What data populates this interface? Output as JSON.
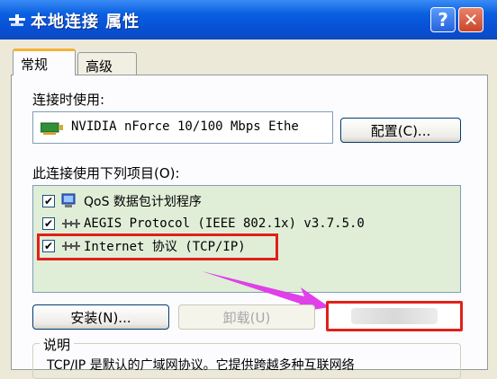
{
  "window": {
    "title": "本地连接 属性",
    "help_symbol": "?",
    "close_symbol": "✕"
  },
  "tabs": [
    {
      "label": "常规",
      "active": true
    },
    {
      "label": "高级",
      "active": false
    }
  ],
  "connect_using": {
    "label": "连接时使用:",
    "adapter": "NVIDIA nForce 10/100 Mbps Ethe",
    "configure_button": "配置(C)..."
  },
  "components": {
    "label": "此连接使用下列项目(O):",
    "items": [
      {
        "checked": true,
        "icon": "qos-scheduler-icon",
        "text": "QoS 数据包计划程序"
      },
      {
        "checked": true,
        "icon": "network-protocol-icon",
        "text": "AEGIS Protocol (IEEE 802.1x) v3.7.5.0"
      },
      {
        "checked": true,
        "icon": "network-protocol-icon",
        "text": "Internet 协议 (TCP/IP)"
      }
    ]
  },
  "buttons": {
    "install": "安装(N)...",
    "uninstall": "卸载(U)"
  },
  "description": {
    "title": "说明",
    "text": "TCP/IP 是默认的广域网协议。它提供跨越多种互联网络"
  },
  "check_mark": "✔",
  "colors": {
    "title_bar": "#0a5fe0",
    "highlight": "#e0201a",
    "arrow": "#e040e8",
    "list_background": "#e0eed8"
  }
}
